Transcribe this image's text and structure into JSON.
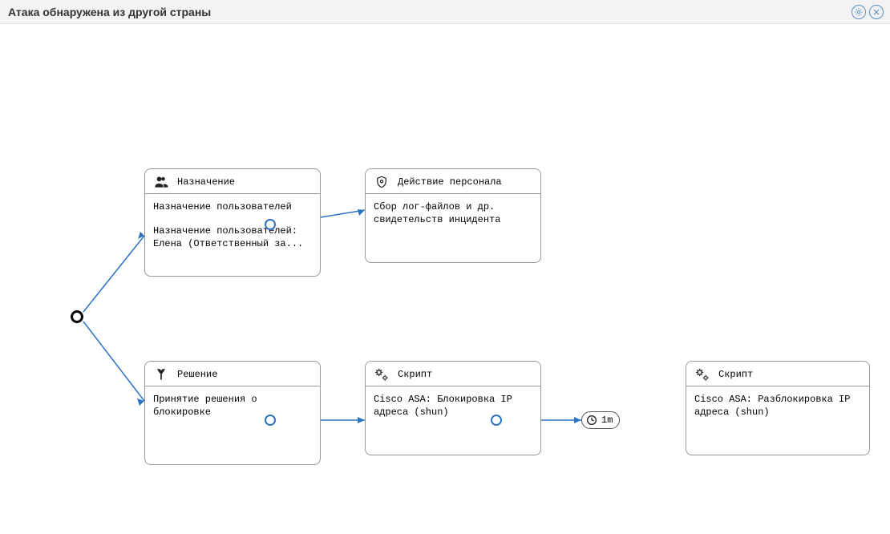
{
  "header": {
    "title": "Атака обнаружена из другой страны"
  },
  "nodes": {
    "assignment": {
      "title": "Назначение",
      "line1": "Назначение пользователей",
      "line2": "Назначение пользователей: Елена (Ответственный за..."
    },
    "personnel_action": {
      "title": "Действие персонала",
      "line1": "Сбор лог-файлов и др. свидетельств инцидента"
    },
    "decision": {
      "title": "Решение",
      "line1": "Принятие решения о блокировке"
    },
    "script1": {
      "title": "Скрипт",
      "line1": "Cisco ASA: Блокировка IP адреса (shun)"
    },
    "script2": {
      "title": "Скрипт",
      "line1": "Cisco ASA: Разблокировка IP адреса (shun)"
    }
  },
  "timer": {
    "label": "1m"
  }
}
